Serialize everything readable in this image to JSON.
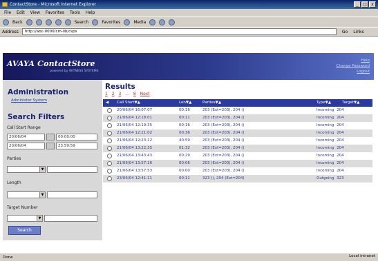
{
  "window": {
    "title": "ContactStore - Microsoft Internet Explorer",
    "buttons": [
      "_",
      "□",
      "x"
    ]
  },
  "menu": [
    "File",
    "Edit",
    "View",
    "Favorites",
    "Tools",
    "Help"
  ],
  "toolbar": {
    "back": "Back",
    "search": "Search",
    "favorites": "Favorites",
    "media": "Media"
  },
  "address": {
    "label": "Address",
    "value": "http://abc-0000/cm-lib/csps",
    "go": "Go",
    "links": "Links"
  },
  "header": {
    "logo": "AVAYA ContactStore",
    "logo_sub": "powered by WITNESS SYSTEMS",
    "links": [
      "Help",
      "Change Password",
      "Logout"
    ]
  },
  "sidebar": {
    "admin_heading": "Administration",
    "admin_link": "Administer System",
    "filters_heading": "Search Filters",
    "call_start_label": "Call Start Range",
    "date_from": "20/06/04",
    "time_from": "00:00:00",
    "date_to": "20/06/04",
    "time_to": "23:59:59",
    "parties_label": "Parties",
    "length_label": "Length",
    "target_label": "Target Number",
    "search_button": "Search"
  },
  "results": {
    "title": "Results",
    "pages": [
      "1",
      "2",
      "3",
      "...",
      "8",
      "Next"
    ],
    "columns": [
      "Call Start",
      "Len",
      "Parties",
      "Type",
      "Target"
    ],
    "rows": [
      {
        "call_start": "20/06/04 16:07:07",
        "len": "00:16",
        "parties": "203 (Ext=203), 204 ()",
        "type": "Incoming",
        "target": "204"
      },
      {
        "call_start": "21/06/04 12:18:01",
        "len": "00:11",
        "parties": "203 (Ext=203), 204 ()",
        "type": "Incoming",
        "target": "204"
      },
      {
        "call_start": "21/06/04 12:19:35",
        "len": "00:16",
        "parties": "203 (Ext=203), 204 ()",
        "type": "Incoming",
        "target": "204"
      },
      {
        "call_start": "21/06/04 12:21:02",
        "len": "00:36",
        "parties": "203 (Ext=203), 204 ()",
        "type": "Incoming",
        "target": "204"
      },
      {
        "call_start": "21/06/04 12:23:12",
        "len": "40:59",
        "parties": "203 (Ext=203), 204 ()",
        "type": "Incoming",
        "target": "204"
      },
      {
        "call_start": "21/06/04 13:22:35",
        "len": "01:32",
        "parties": "203 (Ext=203), 204 ()",
        "type": "Incoming",
        "target": "204"
      },
      {
        "call_start": "21/06/04 13:43:43",
        "len": "00:29",
        "parties": "203 (Ext=203), 204 ()",
        "type": "Incoming",
        "target": "204"
      },
      {
        "call_start": "21/06/04 13:57:16",
        "len": "00:06",
        "parties": "203 (Ext=203), 204 ()",
        "type": "Incoming",
        "target": "204"
      },
      {
        "call_start": "21/06/04 13:57:53",
        "len": "00:00",
        "parties": "203 (Ext=203), 204 ()",
        "type": "Incoming",
        "target": "204"
      },
      {
        "call_start": "23/06/04 12:41:11",
        "len": "00:11",
        "parties": "323 (), 204 (Ext=204)",
        "type": "Outgoing",
        "target": "323"
      }
    ]
  },
  "status": {
    "text": "Done",
    "zone": "Local intranet"
  }
}
